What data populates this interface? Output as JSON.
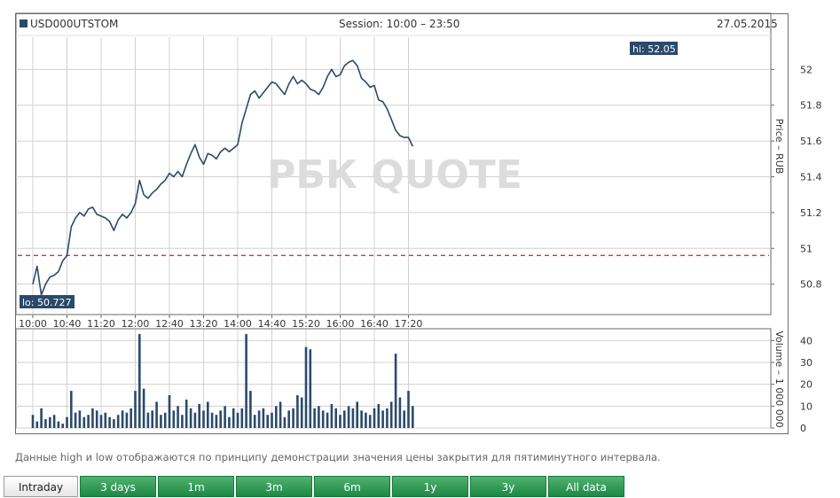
{
  "header": {
    "symbol": "USD000UTSTOM",
    "session": "Session: 10:00 – 23:50",
    "date": "27.05.2015"
  },
  "watermark": "РБК QUOTE",
  "footnote": "Данные high и low отображаются по принципу демонстрации значения цены закрытия для пятиминутного интервала.",
  "tabs": [
    {
      "label": "Intraday",
      "active": true
    },
    {
      "label": "3 days",
      "active": false
    },
    {
      "label": "1m",
      "active": false
    },
    {
      "label": "3m",
      "active": false
    },
    {
      "label": "6m",
      "active": false
    },
    {
      "label": "1y",
      "active": false
    },
    {
      "label": "3y",
      "active": false
    },
    {
      "label": "All data",
      "active": false
    }
  ],
  "colors": {
    "price_line": "#2b4a6b",
    "volume_bars": "#2b4a6b",
    "reference_line": "#e03030",
    "tab_green": "#2a9a50",
    "grid": "#d0d0d0"
  },
  "chart_data": [
    {
      "type": "line",
      "ylabel": "Price – RUB",
      "ylim": [
        50.63,
        52.18
      ],
      "yticks": [
        "50.8",
        "51",
        "51.2",
        "51.4",
        "51.6",
        "51.8",
        "52"
      ],
      "x_ticks": [
        "10:00",
        "10:40",
        "11:20",
        "12:00",
        "12:40",
        "13:20",
        "14:00",
        "14:40",
        "15:20",
        "16:00",
        "16:40",
        "17:20"
      ],
      "x_start": "10:00",
      "grid": true,
      "reference_level": 50.96,
      "hi_label": "hi: 52.05",
      "lo_label": "lo: 50.727",
      "series": [
        {
          "x": [
            "10:00",
            "10:05",
            "10:10",
            "10:15",
            "10:20",
            "10:25",
            "10:30",
            "10:35",
            "10:40",
            "10:45",
            "10:50",
            "10:55",
            "11:00",
            "11:05",
            "11:10",
            "11:15",
            "11:20",
            "11:25",
            "11:30",
            "11:35",
            "11:40",
            "11:45",
            "11:50",
            "11:55",
            "12:00",
            "12:05",
            "12:10",
            "12:15",
            "12:20",
            "12:25",
            "12:30",
            "12:35",
            "12:40",
            "12:45",
            "12:50",
            "12:55",
            "13:00",
            "13:05",
            "13:10",
            "13:15",
            "13:20",
            "13:25",
            "13:30",
            "13:35",
            "13:40",
            "13:45",
            "13:50",
            "13:55",
            "14:00",
            "14:05",
            "14:10",
            "14:15",
            "14:20",
            "14:25",
            "14:30",
            "14:35",
            "14:40",
            "14:45",
            "14:50",
            "14:55",
            "15:00",
            "15:05",
            "15:10",
            "15:15",
            "15:20",
            "15:25",
            "15:30",
            "15:35",
            "15:40",
            "15:45",
            "15:50",
            "15:55",
            "16:00",
            "16:05",
            "16:10",
            "16:15",
            "16:20",
            "16:25",
            "16:30",
            "16:35",
            "16:40",
            "16:45",
            "16:50",
            "16:55",
            "17:00",
            "17:05",
            "17:10",
            "17:15",
            "17:20",
            "17:25"
          ],
          "values": [
            50.8,
            50.9,
            50.74,
            50.8,
            50.84,
            50.85,
            50.87,
            50.93,
            50.96,
            51.12,
            51.17,
            51.2,
            51.18,
            51.22,
            51.23,
            51.19,
            51.18,
            51.17,
            51.15,
            51.1,
            51.16,
            51.19,
            51.17,
            51.2,
            51.25,
            51.38,
            51.3,
            51.28,
            51.31,
            51.33,
            51.36,
            51.38,
            51.42,
            51.4,
            51.43,
            51.4,
            51.47,
            51.53,
            51.58,
            51.51,
            51.47,
            51.53,
            51.52,
            51.5,
            51.54,
            51.56,
            51.54,
            51.56,
            51.58,
            51.7,
            51.78,
            51.86,
            51.88,
            51.84,
            51.87,
            51.9,
            51.93,
            51.92,
            51.89,
            51.86,
            51.92,
            51.96,
            51.92,
            51.94,
            51.92,
            51.89,
            51.88,
            51.86,
            51.9,
            51.96,
            52.0,
            51.96,
            51.97,
            52.02,
            52.04,
            52.05,
            52.02,
            51.95,
            51.93,
            51.9,
            51.91,
            51.83,
            51.82,
            51.78,
            51.72,
            51.66,
            51.63,
            51.62,
            51.62,
            51.57
          ]
        }
      ]
    },
    {
      "type": "bar",
      "ylabel": "Volume – 1 000 000",
      "ylim": [
        0,
        45
      ],
      "yticks": [
        "0",
        "10",
        "20",
        "30",
        "40"
      ],
      "grid": true,
      "x_start": "10:00",
      "interval_min": 5,
      "values": [
        6,
        3,
        9,
        4,
        5,
        6,
        3,
        2,
        5,
        17,
        7,
        8,
        5,
        6,
        9,
        8,
        6,
        7,
        5,
        4,
        6,
        8,
        7,
        9,
        17,
        43,
        18,
        7,
        8,
        12,
        6,
        7,
        15,
        8,
        10,
        6,
        13,
        9,
        7,
        11,
        8,
        12,
        7,
        6,
        8,
        10,
        5,
        9,
        7,
        9,
        43,
        17,
        6,
        8,
        9,
        6,
        7,
        10,
        12,
        5,
        8,
        9,
        15,
        14,
        37,
        36,
        9,
        10,
        8,
        7,
        11,
        9,
        6,
        8,
        10,
        9,
        12,
        8,
        7,
        6,
        9,
        11,
        8,
        9,
        12,
        34,
        14,
        8,
        17,
        10
      ]
    }
  ]
}
